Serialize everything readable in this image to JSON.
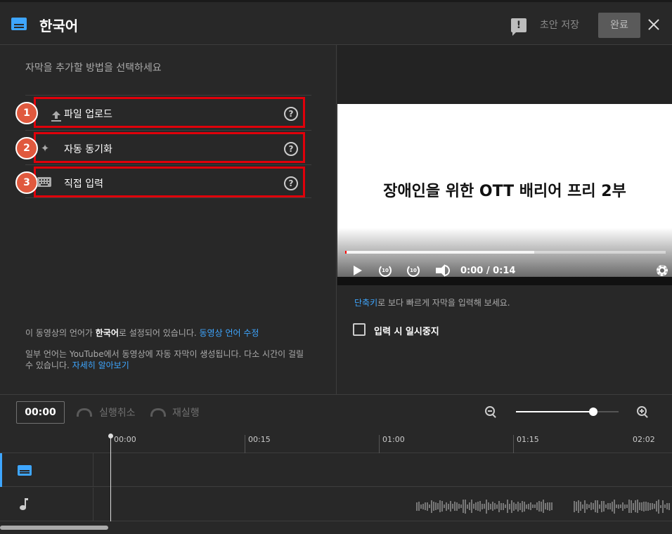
{
  "header": {
    "title": "한국어",
    "draft_label": "초안 저장",
    "done_label": "완료"
  },
  "left": {
    "instruction": "자막을 추가할 방법을 선택하세요",
    "options": [
      {
        "badge": "1",
        "label": "파일 업로드",
        "icon": "upload-icon",
        "help": "?"
      },
      {
        "badge": "2",
        "label": "자동 동기화",
        "icon": "sparkle-icon",
        "help": "?"
      },
      {
        "badge": "3",
        "label": "직접 입력",
        "icon": "keyboard-icon",
        "help": "?"
      }
    ],
    "info1_prefix": "이 동영상의 언어가 ",
    "info1_lang": "한국어",
    "info1_suffix": "로 설정되어 있습니다. ",
    "info1_link": "동영상 언어 수정",
    "info2_text": "일부 언어는 YouTube에서 동영상에 자동 자막이 생성됩니다. 다소 시간이 걸릴 수 있습니다. ",
    "info2_link": "자세히 알아보기"
  },
  "right": {
    "video_title": "장애인을 위한 OTT 배리어 프리 2부",
    "time_display": "0:00 / 0:14",
    "progress_buffered": 0.59,
    "shortcut_link": "단축키",
    "shortcut_text": "로 보다 빠르게 자막을 입력해 보세요.",
    "pause_checkbox_label": "입력 시 일시중지",
    "pause_checked": false
  },
  "timeline": {
    "current_time": "00:00",
    "undo_label": "실행취소",
    "redo_label": "재실행",
    "zoom_level": 0.75,
    "ticks": [
      "00:00",
      "00:15",
      "01:00",
      "01:15",
      "02:02"
    ]
  },
  "colors": {
    "accent": "#3ea6ff",
    "highlight": "#e0000a",
    "badge": "#e0593e"
  }
}
